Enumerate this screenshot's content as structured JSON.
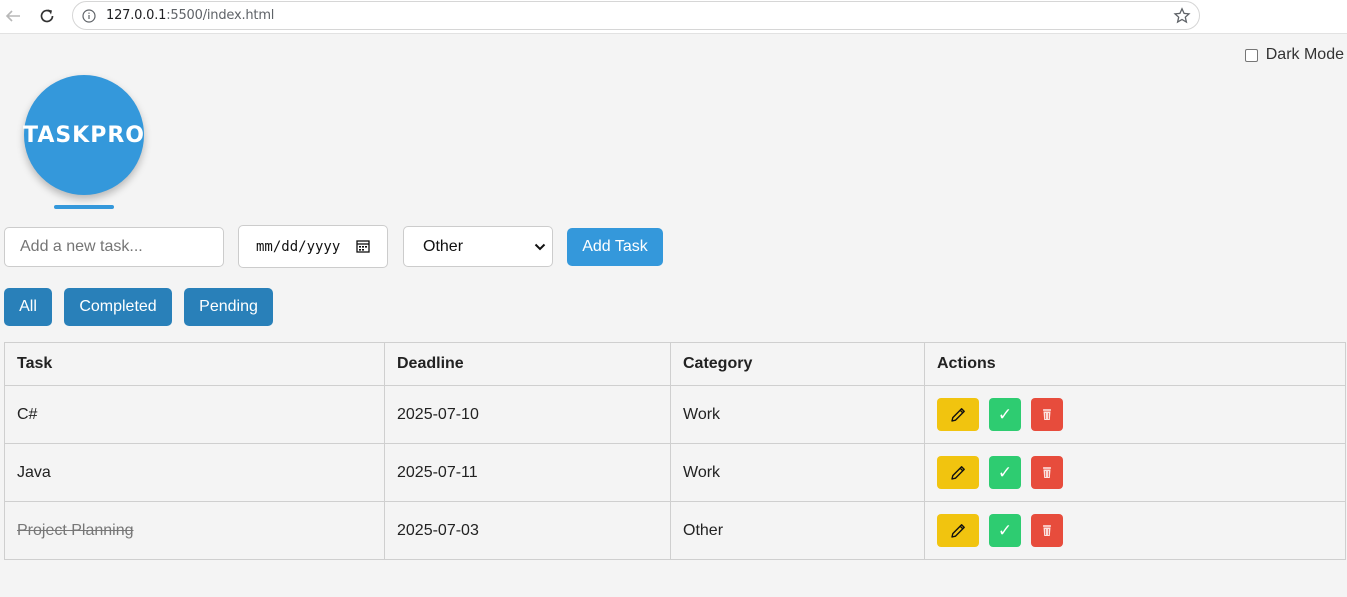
{
  "browser": {
    "url_host": "127.0.0.1",
    "url_rest": ":5500/index.html"
  },
  "dark_mode": {
    "label": "Dark Mode",
    "checked": false
  },
  "logo": {
    "text": "TASKPRO",
    "color": "#3498db"
  },
  "form": {
    "task_placeholder": "Add a new task...",
    "date_placeholder": "mm/dd/yyyy",
    "category_selected": "Other",
    "add_label": "Add Task"
  },
  "filters": [
    "All",
    "Completed",
    "Pending"
  ],
  "table": {
    "headers": [
      "Task",
      "Deadline",
      "Category",
      "Actions"
    ],
    "rows": [
      {
        "task": "C#",
        "deadline": "2025-07-10",
        "category": "Work",
        "completed": false
      },
      {
        "task": "Java",
        "deadline": "2025-07-11",
        "category": "Work",
        "completed": false
      },
      {
        "task": "Project Planning",
        "deadline": "2025-07-03",
        "category": "Other",
        "completed": true
      }
    ]
  },
  "colors": {
    "primary": "#3498db",
    "filter": "#2980b9",
    "edit": "#f1c40f",
    "complete": "#2ecc71",
    "delete": "#e74c3c"
  },
  "icons": {
    "edit": "pencil-icon",
    "complete": "check-icon",
    "delete": "trash-icon"
  },
  "complete_glyph": "✓"
}
